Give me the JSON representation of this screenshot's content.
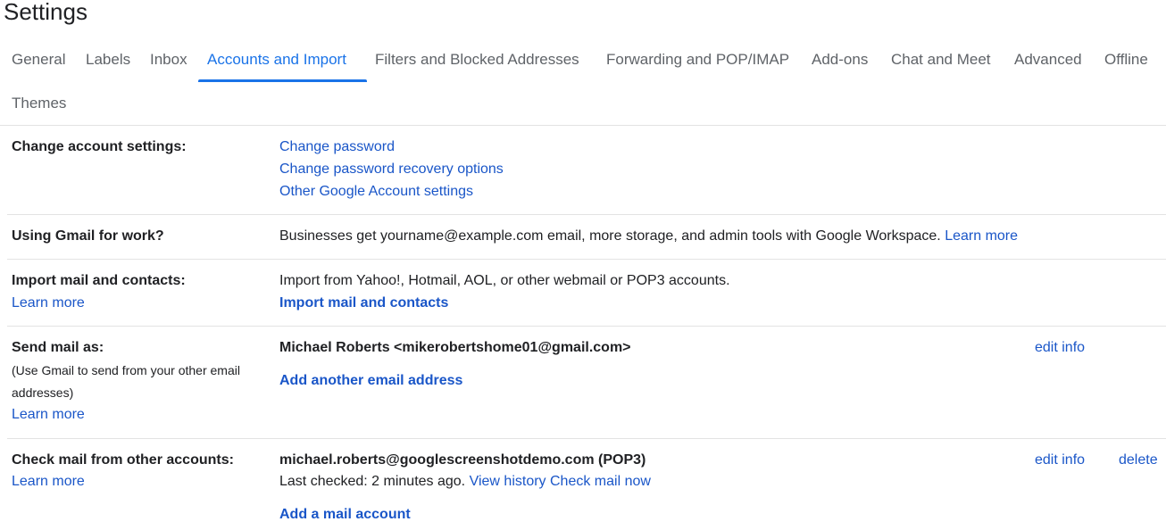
{
  "page": {
    "title": "Settings"
  },
  "tabs": [
    {
      "label": "General",
      "active": false
    },
    {
      "label": "Labels",
      "active": false
    },
    {
      "label": "Inbox",
      "active": false
    },
    {
      "label": "Accounts and Import",
      "active": true
    },
    {
      "label": "Filters and Blocked Addresses",
      "active": false
    },
    {
      "label": "Forwarding and POP/IMAP",
      "active": false
    },
    {
      "label": "Add-ons",
      "active": false
    },
    {
      "label": "Chat and Meet",
      "active": false
    },
    {
      "label": "Advanced",
      "active": false
    },
    {
      "label": "Offline",
      "active": false
    },
    {
      "label": "Themes",
      "active": false
    }
  ],
  "sections": {
    "change_account": {
      "label": "Change account settings:",
      "links": [
        "Change password",
        "Change password recovery options",
        "Other Google Account settings"
      ]
    },
    "gmail_work": {
      "label": "Using Gmail for work?",
      "text": "Businesses get yourname@example.com email, more storage, and admin tools with Google Workspace.",
      "link": "Learn more"
    },
    "import": {
      "label": "Import mail and contacts:",
      "learn_more": "Learn more",
      "text": "Import from Yahoo!, Hotmail, AOL, or other webmail or POP3 accounts.",
      "action": "Import mail and contacts"
    },
    "send_as": {
      "label": "Send mail as:",
      "desc_line1": "(Use Gmail to send from your other email",
      "desc_line2": "addresses)",
      "learn_more": "Learn more",
      "identity": "Michael Roberts <mikerobertshome01@gmail.com>",
      "edit": "edit info",
      "action": "Add another email address"
    },
    "check_mail": {
      "label": "Check mail from other accounts:",
      "learn_more": "Learn more",
      "account": "michael.roberts@googlescreenshotdemo.com (POP3)",
      "last_checked": "Last checked: 2 minutes ago.",
      "view_history": "View history",
      "check_now": "Check mail now",
      "edit": "edit info",
      "delete": "delete",
      "action": "Add a mail account"
    }
  }
}
